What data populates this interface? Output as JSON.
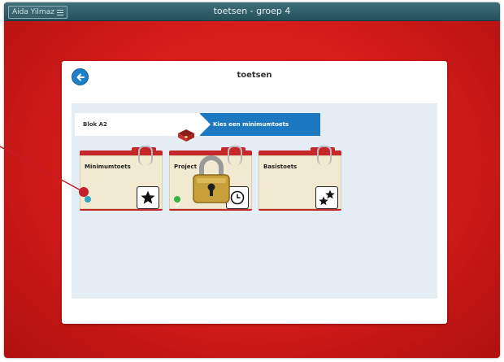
{
  "topbar": {
    "user_name": "Aida Yilmaz",
    "title": "toetsen - groep 4"
  },
  "card": {
    "title": "toetsen"
  },
  "breadcrumb": {
    "block": "Blok A2",
    "step": "Kies een minimumtoets"
  },
  "folders": [
    {
      "label": "Minimumtoets",
      "icon": "star-icon",
      "status": "pending"
    },
    {
      "label": "Project",
      "icon": "clock-icon",
      "status": "completed",
      "locked": true
    },
    {
      "label": "Basistoets",
      "icon": "two-stars-icon",
      "status": "none"
    }
  ],
  "colors": {
    "background": "#d81e1b",
    "topbar": "#2e5f6a",
    "accent": "#1c78c0",
    "folder_tab": "#c6272b"
  }
}
